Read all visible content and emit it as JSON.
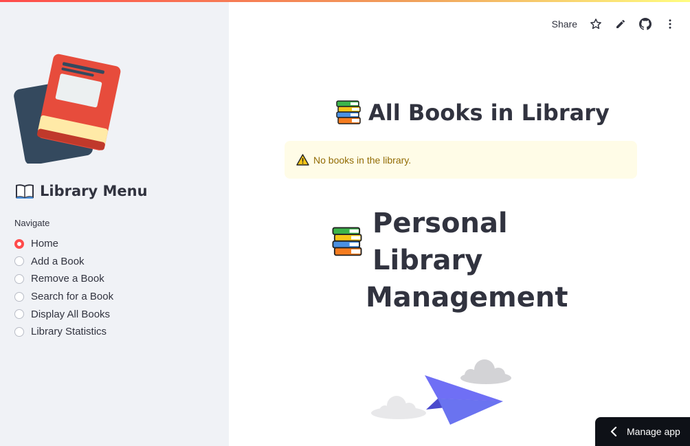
{
  "colors": {
    "accent": "#ff4b4b",
    "warning_bg": "#fffce7",
    "warning_text": "#926c05",
    "sidebar_bg": "#f0f2f6"
  },
  "header": {
    "share_label": "Share",
    "icons": [
      "star-icon",
      "pencil-icon",
      "github-icon",
      "more-vertical-icon"
    ]
  },
  "sidebar": {
    "title": "Library Menu",
    "nav_label": "Navigate",
    "options": [
      "Home",
      "Add a Book",
      "Remove a Book",
      "Search for a Book",
      "Display All Books",
      "Library Statistics"
    ],
    "selected": "Home"
  },
  "main": {
    "section_title": "All Books in Library",
    "alert_text": "No books in the library.",
    "page_title_line1": "Personal Library",
    "page_title_line2": "Management"
  },
  "footer": {
    "manage_label": "Manage app"
  }
}
